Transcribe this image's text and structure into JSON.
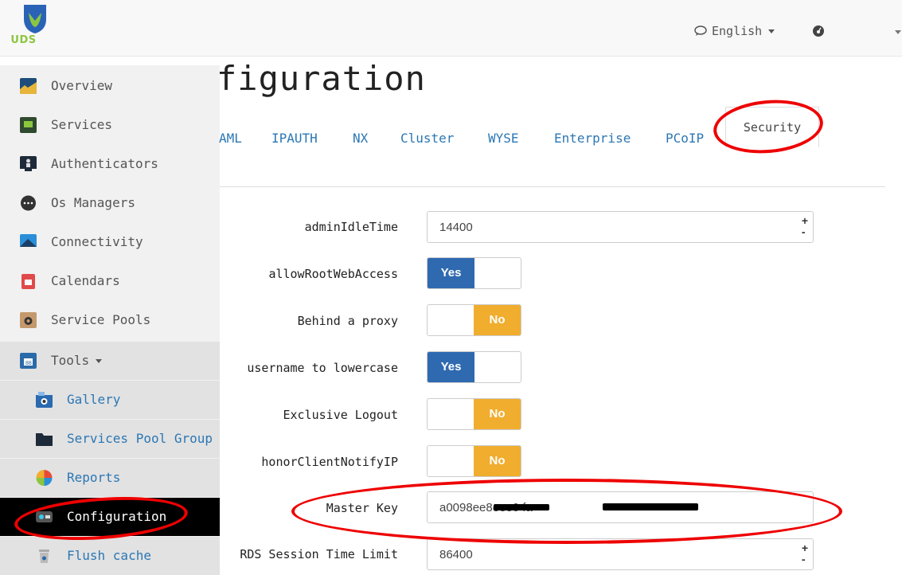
{
  "topbar": {
    "logo_text": "UDS",
    "language_label": "English",
    "brand_colors": {
      "logo_blue": "#2a63b6",
      "logo_green": "#8cc63f"
    }
  },
  "sidebar": {
    "items": [
      {
        "label": "Overview",
        "icon": "overview-icon"
      },
      {
        "label": "Services",
        "icon": "services-icon"
      },
      {
        "label": "Authenticators",
        "icon": "authenticators-icon"
      },
      {
        "label": "Os Managers",
        "icon": "os-managers-icon"
      },
      {
        "label": "Connectivity",
        "icon": "connectivity-icon"
      },
      {
        "label": "Calendars",
        "icon": "calendar-icon"
      },
      {
        "label": "Service Pools",
        "icon": "service-pools-icon"
      },
      {
        "label": "Tools",
        "icon": "tools-icon"
      }
    ],
    "tools_sub": [
      {
        "label": "Gallery",
        "icon": "gallery-icon"
      },
      {
        "label": "Services Pool Group",
        "icon": "folder-icon"
      },
      {
        "label": "Reports",
        "icon": "reports-icon"
      },
      {
        "label": "Configuration",
        "icon": "configuration-icon"
      },
      {
        "label": "Flush cache",
        "icon": "trash-icon"
      }
    ]
  },
  "main": {
    "title": "figuration",
    "tabs": [
      "AML",
      "IPAUTH",
      "NX",
      "Cluster",
      "WYSE",
      "Enterprise",
      "PCoIP",
      "Security"
    ],
    "active_tab": "Security",
    "fields": {
      "adminIdleTime": {
        "label": "adminIdleTime",
        "value": "14400"
      },
      "allowRootWebAccess": {
        "label": "allowRootWebAccess",
        "value": "Yes"
      },
      "behindProxy": {
        "label": "Behind a proxy",
        "value": "No"
      },
      "usernameLowercase": {
        "label": "username to lowercase",
        "value": "Yes"
      },
      "exclusiveLogout": {
        "label": "Exclusive Logout",
        "value": "No"
      },
      "honorClientNotifyIP": {
        "label": "honorClientNotifyIP",
        "value": "No"
      },
      "masterKey": {
        "label": "Master Key",
        "value": "a0098ee8eee0 fa"
      },
      "rdsSessionTimeLimit": {
        "label": "RDS Session Time Limit",
        "value": "86400"
      }
    },
    "spinner": {
      "plus": "+",
      "minus": "-"
    },
    "colors": {
      "yes": "#2f6ab0",
      "no": "#f0ad2e",
      "link": "#2b77b4",
      "highlight": "#e00000"
    }
  }
}
